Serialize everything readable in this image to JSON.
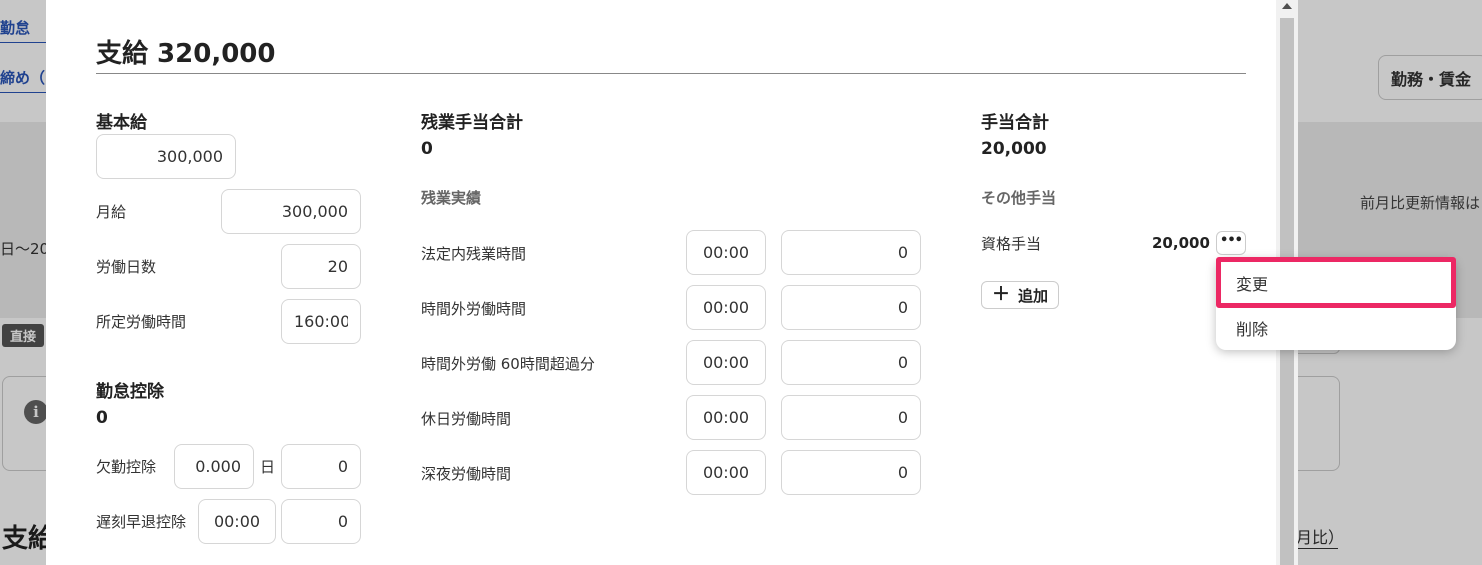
{
  "background": {
    "nav_link_1": "勤怠",
    "nav_link_2": "締め（",
    "right_button": "勤務・賃金",
    "date_range": "日〜20",
    "diff_info": "前月比更新情報は",
    "chip": "直接",
    "info_icon": "info-icon",
    "section_title": "支給",
    "section_right": "月比）"
  },
  "modal": {
    "title": "支給 320,000",
    "basic_pay": {
      "heading": "基本給",
      "value": "300,000",
      "rows": [
        {
          "label": "月給",
          "value": "300,000"
        },
        {
          "label": "労働日数",
          "value": "20"
        },
        {
          "label": "所定労働時間",
          "value": "160:00"
        }
      ]
    },
    "deduction": {
      "heading": "勤怠控除",
      "total": "0",
      "absence": {
        "label": "欠勤控除",
        "days": "0.000",
        "unit": "日",
        "amount": "0"
      },
      "late": {
        "label": "遅刻早退控除",
        "time": "00:00",
        "amount": "0"
      }
    },
    "overtime": {
      "heading": "残業手当合計",
      "total": "0",
      "sub_heading": "残業実績",
      "rows": [
        {
          "label": "法定内残業時間",
          "time": "00:00",
          "amount": "0"
        },
        {
          "label": "時間外労働時間",
          "time": "00:00",
          "amount": "0"
        },
        {
          "label": "時間外労働 60時間超過分",
          "time": "00:00",
          "amount": "0"
        },
        {
          "label": "休日労働時間",
          "time": "00:00",
          "amount": "0"
        },
        {
          "label": "深夜労働時間",
          "time": "00:00",
          "amount": "0"
        }
      ]
    },
    "allowance": {
      "heading": "手当合計",
      "total": "20,000",
      "sub_heading": "その他手当",
      "item_label": "資格手当",
      "item_amount": "20,000",
      "more_label": "•••",
      "add_label": "追加"
    }
  },
  "menu": {
    "items": [
      "変更",
      "削除"
    ],
    "highlight_color": "#ec2864"
  }
}
